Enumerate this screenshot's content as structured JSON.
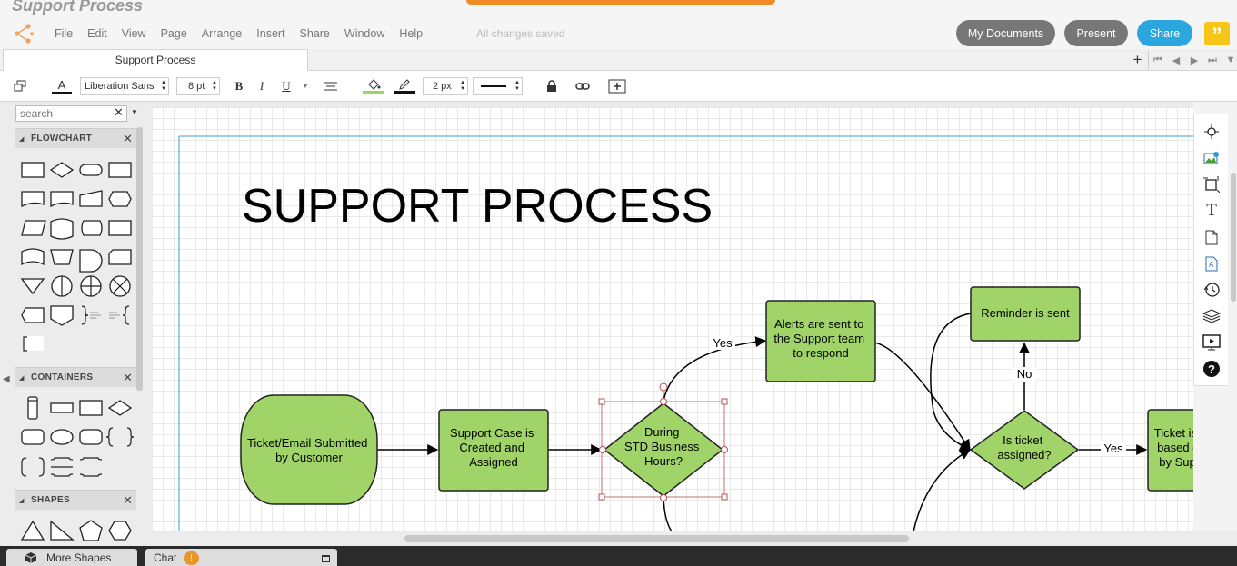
{
  "app": {
    "document_title": "Support Process",
    "save_status": "All changes saved",
    "menu": [
      "File",
      "Edit",
      "View",
      "Page",
      "Arrange",
      "Insert",
      "Share",
      "Window",
      "Help"
    ],
    "buttons": {
      "my_documents": "My Documents",
      "present": "Present",
      "share": "Share",
      "quote": "”"
    }
  },
  "tabs": {
    "page_tab": "Support Process",
    "add_page": "+"
  },
  "toolbar": {
    "font_family": "Liberation Sans",
    "font_size": "8 pt",
    "bold": "B",
    "italic": "I",
    "underline": "U",
    "line_width": "2 px",
    "text_color_letter": "A",
    "fill_color": "#a0d468",
    "line_color": "#111111"
  },
  "sidebar": {
    "search_placeholder": "search",
    "sections": [
      {
        "label": "FLOWCHART"
      },
      {
        "label": "CONTAINERS"
      },
      {
        "label": "SHAPES"
      }
    ]
  },
  "diagram": {
    "title": "SUPPORT PROCESS",
    "shape_fill": "#a0d468",
    "nodes": {
      "submitted": "Ticket/Email Submitted by Customer",
      "support_case": "Support Case is Created and Assigned",
      "business_hours": "During STD Business Hours?",
      "alerts": "Alerts are sent to the Support team to respond",
      "reminder": "Reminder is sent",
      "is_assigned": "Is ticket assigned?",
      "reviewed": "Ticket is reviewed based on priority by Support team"
    },
    "edge_labels": {
      "yes_1": "Yes",
      "no": "No",
      "yes_2": "Yes"
    }
  },
  "bottom": {
    "more_shapes": "More Shapes",
    "chat": "Chat",
    "chat_badge": "!"
  }
}
